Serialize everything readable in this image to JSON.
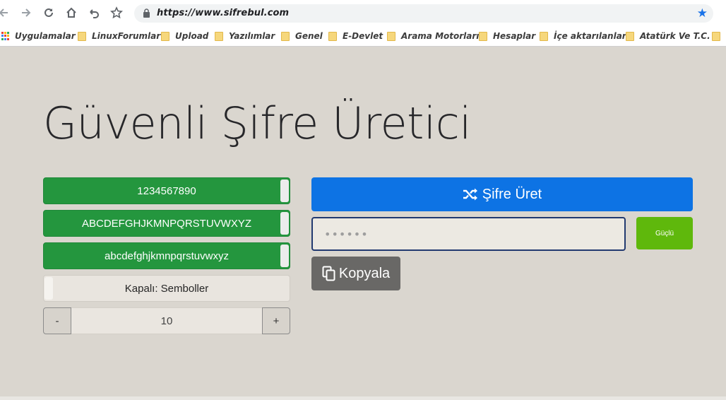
{
  "browser": {
    "url": "https://www.sifrebul.com",
    "bookmarks": [
      {
        "label": "Uygulamalar",
        "icon": "apps-icon"
      },
      {
        "label": "LinuxForumlar",
        "icon": "folder-icon"
      },
      {
        "label": "Upload",
        "icon": "folder-icon"
      },
      {
        "label": "Yazılımlar",
        "icon": "folder-icon"
      },
      {
        "label": "Genel",
        "icon": "folder-icon"
      },
      {
        "label": "E-Devlet",
        "icon": "folder-icon"
      },
      {
        "label": "Arama Motorları",
        "icon": "folder-icon"
      },
      {
        "label": "Hesaplar",
        "icon": "folder-icon"
      },
      {
        "label": "İçe aktarılanlar",
        "icon": "folder-icon"
      },
      {
        "label": "Atatürk Ve T.C.",
        "icon": "folder-icon"
      }
    ]
  },
  "page": {
    "title": "Güvenli Şifre Üretici",
    "toggles": {
      "digits": "1234567890",
      "uppercase": "ABCDEFGHJKMNPQRSTUVWXYZ",
      "lowercase": "abcdefghjkmnpqrstuvwxyz",
      "symbols": "Kapalı: Semboller"
    },
    "length": {
      "minus": "-",
      "value": "10",
      "plus": "+"
    },
    "generate_label": "Şifre Üret",
    "password_value": "••••••",
    "strength_label": "Güçlü",
    "copy_label": "Kopyala"
  },
  "colors": {
    "toggle_on": "#24963e",
    "generate": "#0d73e4",
    "strength": "#5fb80c",
    "copy": "#696866",
    "background": "#dad6cf"
  }
}
